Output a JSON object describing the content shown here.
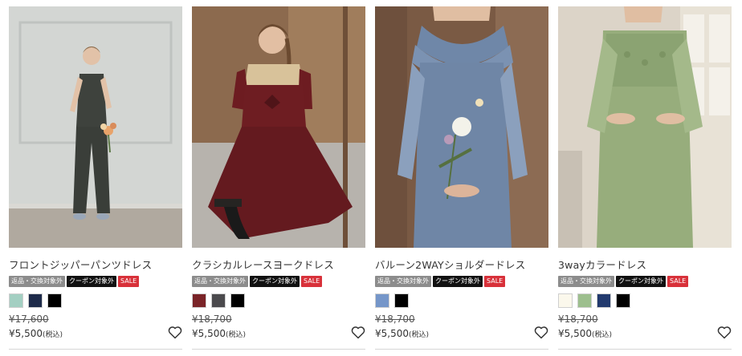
{
  "products": [
    {
      "name": "フロントジッパーパンツドレス",
      "tags": [
        {
          "label": "返品・交換対象外",
          "style": "grey"
        },
        {
          "label": "クーポン対象外",
          "style": "black"
        },
        {
          "label": "SALE",
          "style": "red"
        }
      ],
      "colors": [
        "#a3cfc2",
        "#1e2b4a",
        "#000000"
      ],
      "old_price": "¥17,600",
      "price": "¥5,500",
      "tax_label": "(税込)",
      "photo_icon": "model-photo"
    },
    {
      "name": "クラシカルレースヨークドレス",
      "tags": [
        {
          "label": "返品・交換対象外",
          "style": "grey"
        },
        {
          "label": "クーポン対象外",
          "style": "black"
        },
        {
          "label": "SALE",
          "style": "red"
        }
      ],
      "colors": [
        "#7a2428",
        "#4b4a4d",
        "#000000"
      ],
      "old_price": "¥18,700",
      "price": "¥5,500",
      "tax_label": "(税込)",
      "photo_icon": "model-photo"
    },
    {
      "name": "バルーン2WAYショルダードレス",
      "tags": [
        {
          "label": "返品・交換対象外",
          "style": "grey"
        },
        {
          "label": "クーポン対象外",
          "style": "black"
        },
        {
          "label": "SALE",
          "style": "red"
        }
      ],
      "colors": [
        "#7596c9",
        "#000000"
      ],
      "old_price": "¥18,700",
      "price": "¥5,500",
      "tax_label": "(税込)",
      "photo_icon": "model-photo"
    },
    {
      "name": "3wayカラードレス",
      "tags": [
        {
          "label": "返品・交換対象外",
          "style": "grey"
        },
        {
          "label": "クーポン対象外",
          "style": "black"
        },
        {
          "label": "SALE",
          "style": "red"
        }
      ],
      "colors": [
        "#fbf8ec",
        "#9dbf8e",
        "#223a6e",
        "#000000"
      ],
      "old_price": "¥18,700",
      "price": "¥5,500",
      "tax_label": "(税込)",
      "photo_icon": "model-photo"
    }
  ],
  "favorite_icon": "heart-outline-icon"
}
